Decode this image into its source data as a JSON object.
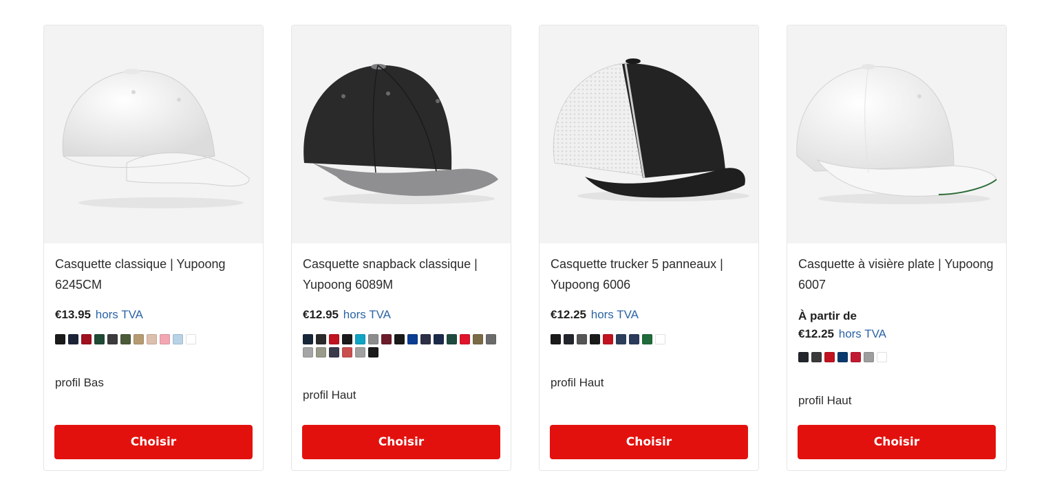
{
  "products": [
    {
      "image": "white-dad-cap",
      "title": "Casquette classique | Yupoong 6245CM",
      "price": "€13.95",
      "tax_label": "hors TVA",
      "swatches": [
        "#1a1a1a",
        "#1c2336",
        "#a0101f",
        "#1f4a35",
        "#3b3b3b",
        "#4d5a3a",
        "#b69b72",
        "#ddbfae",
        "#f2a7b3",
        "#b8d3e6",
        "#ffffff"
      ],
      "profile": "profil Bas",
      "button": "Choisir"
    },
    {
      "image": "black-grey-snapback",
      "title": "Casquette snapback classique | Yupoong 6089M",
      "price": "€12.95",
      "tax_label": "hors TVA",
      "swatches": [
        "#18263a",
        "#2a2a2a",
        "#c1121f",
        "#1a1a1a",
        "#0fa3c4",
        "#8c8c8c",
        "#6b1b2a",
        "#1a1a1a",
        "#0b3d91",
        "#2c2f45",
        "#1b2a4a",
        "#1f4b3f",
        "#e0142a",
        "#7a6a46",
        "#6b6b6b",
        "#a5a5a5",
        "#9a9a8a",
        "#3a3a4a",
        "#c94f4f",
        "#a0a0a0",
        "#1a1a1a"
      ],
      "profile": "profil Haut",
      "button": "Choisir"
    },
    {
      "image": "black-white-trucker",
      "title": "Casquette trucker 5 panneaux | Yupoong 6006",
      "price": "€12.25",
      "tax_label": "hors TVA",
      "swatches": [
        "#1a1a1a",
        "#23252c",
        "#555555",
        "#1a1a1a",
        "#c1121f",
        "#2c3e5c",
        "#2a3a5a",
        "#1f6b3a",
        "#ffffff"
      ],
      "profile": "profil Haut",
      "button": "Choisir"
    },
    {
      "image": "white-flat-visor-cap",
      "title": "Casquette à visière plate | Yupoong 6007",
      "from_label": "À partir de",
      "price": "€12.25",
      "tax_label": "hors TVA",
      "swatches": [
        "#23252c",
        "#3a3a3a",
        "#c1121f",
        "#0a3a6b",
        "#c11a33",
        "#9e9e9e",
        "#ffffff"
      ],
      "profile": "profil Haut",
      "button": "Choisir"
    }
  ]
}
